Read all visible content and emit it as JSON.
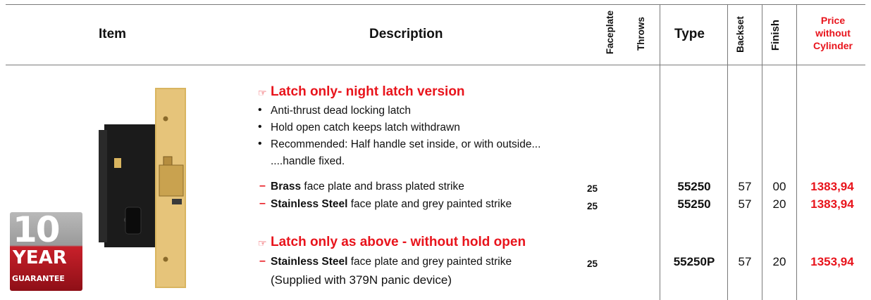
{
  "headers": {
    "item": "Item",
    "description": "Description",
    "faceplate": "Faceplate",
    "throws": "Throws",
    "type": "Type",
    "backset": "Backset",
    "finish": "Finish",
    "price_line1": "Price",
    "price_line2": "without",
    "price_line3": "Cylinder"
  },
  "colors": {
    "accent_red": "#e8141c",
    "brass": "#d9b560",
    "lock_body": "#1b1b1b"
  },
  "badge": {
    "line1": "10",
    "line2": "YEAR",
    "line3": "GUARANTEE"
  },
  "section1": {
    "icon": "pointing-hand-icon",
    "heading": "Latch only- night latch version",
    "bullets": [
      "Anti-thrust dead locking latch",
      "Hold open catch keeps latch withdrawn",
      "Recommended: Half handle set inside, or with outside...",
      "....handle fixed."
    ],
    "rows": [
      {
        "bold": "Brass",
        "rest": " face plate and brass plated strike",
        "faceplate": "25",
        "type": "55250",
        "backset": "57",
        "finish": "00",
        "price": "1383,94"
      },
      {
        "bold": "Stainless Steel",
        "rest": " face plate and grey painted strike",
        "faceplate": "25",
        "type": "55250",
        "backset": "57",
        "finish": "20",
        "price": "1383,94"
      }
    ]
  },
  "section2": {
    "icon": "pointing-hand-icon",
    "heading": "Latch only as above - without hold open",
    "rows": [
      {
        "bold": "Stainless Steel",
        "rest": " face plate and grey painted strike",
        "faceplate": "25",
        "type": "55250P",
        "backset": "57",
        "finish": "20",
        "price": "1353,94"
      }
    ],
    "note": "(Supplied with 379N panic device)"
  }
}
